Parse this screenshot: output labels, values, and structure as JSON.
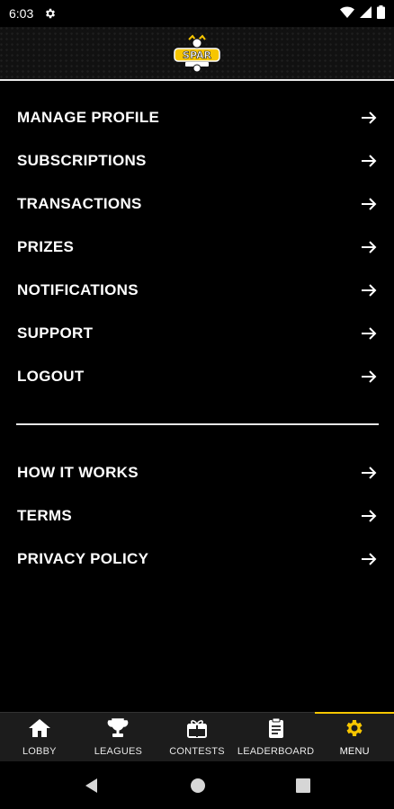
{
  "status_bar": {
    "time": "6:03"
  },
  "menu_primary": [
    {
      "label": "MANAGE PROFILE"
    },
    {
      "label": "SUBSCRIPTIONS"
    },
    {
      "label": "TRANSACTIONS"
    },
    {
      "label": "PRIZES"
    },
    {
      "label": "NOTIFICATIONS"
    },
    {
      "label": "SUPPORT"
    },
    {
      "label": "LOGOUT"
    }
  ],
  "menu_secondary": [
    {
      "label": "HOW IT WORKS"
    },
    {
      "label": "TERMS"
    },
    {
      "label": "PRIVACY POLICY"
    }
  ],
  "bottom_nav": [
    {
      "label": "LOBBY",
      "icon": "home-icon"
    },
    {
      "label": "LEAGUES",
      "icon": "trophy-icon"
    },
    {
      "label": "CONTESTS",
      "icon": "gift-icon"
    },
    {
      "label": "LEADERBOARD",
      "icon": "clipboard-icon"
    },
    {
      "label": "MENU",
      "icon": "gear-icon",
      "active": true
    }
  ],
  "colors": {
    "accent": "#f7c600",
    "background": "#000000",
    "nav_background": "#1c1c1c"
  }
}
